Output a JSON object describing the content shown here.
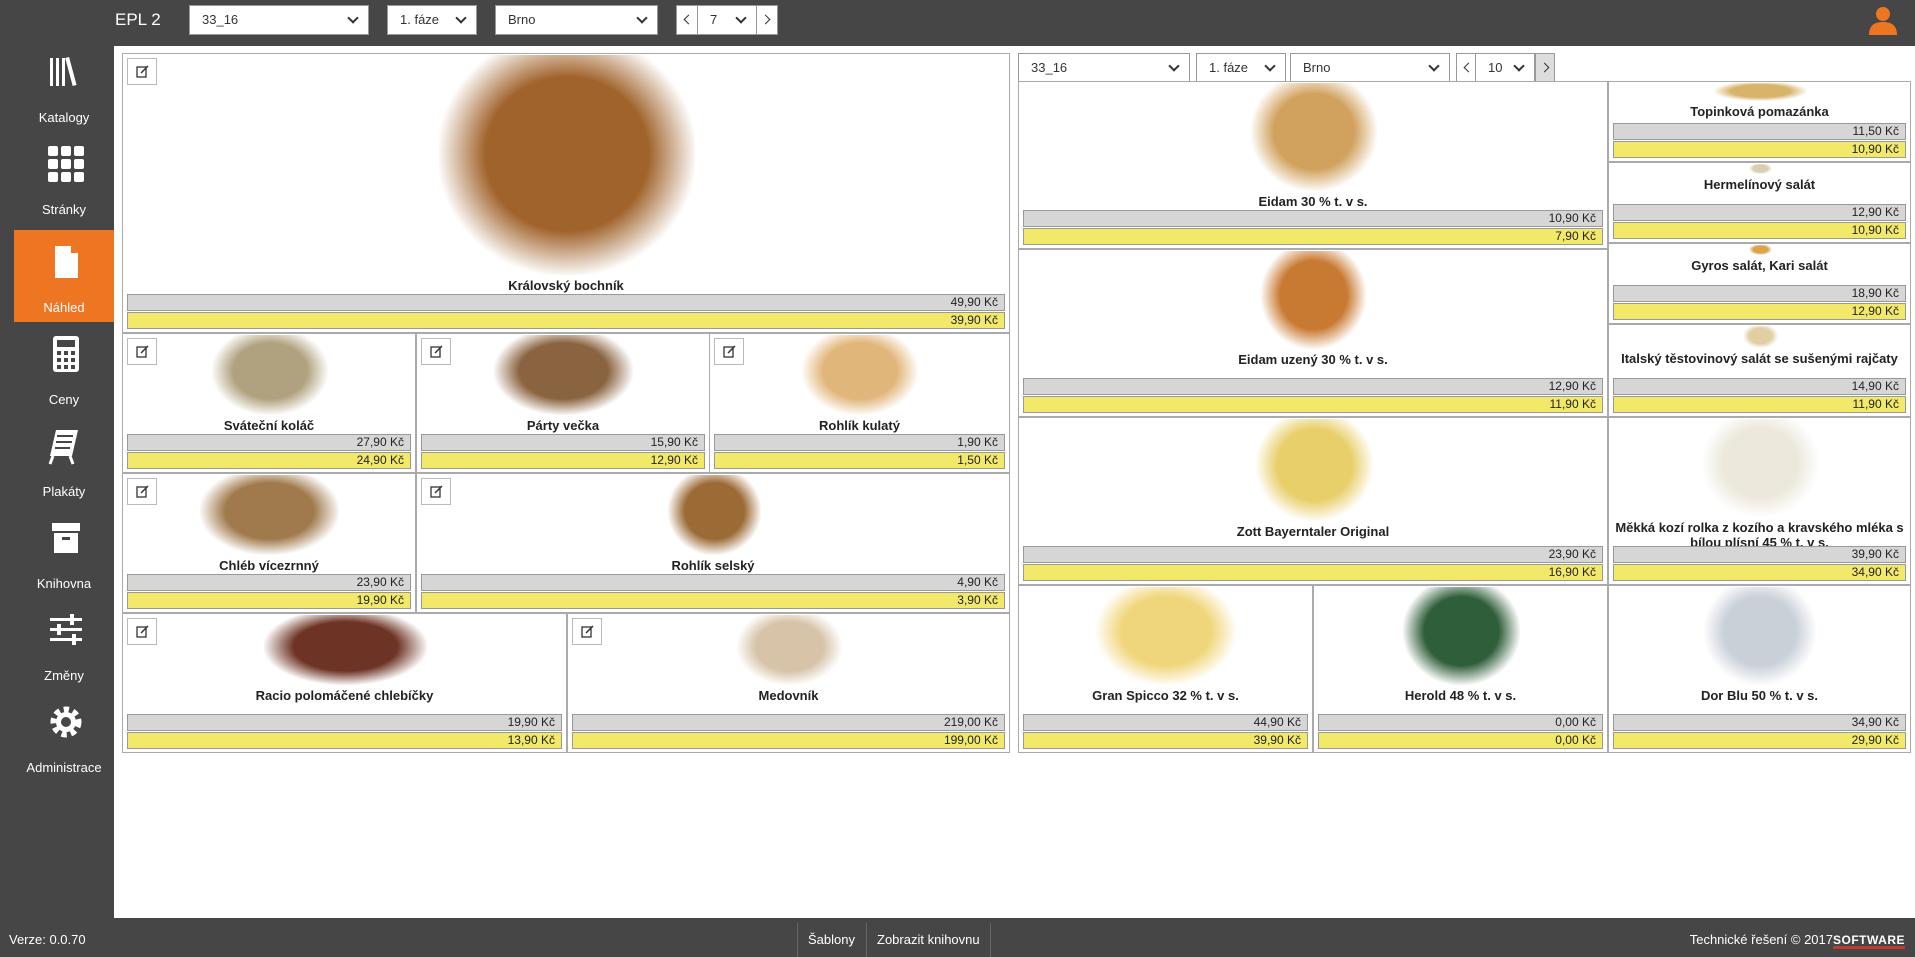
{
  "app": {
    "title": "EPL 2",
    "version": "Verze: 0.0.70"
  },
  "topbar": {
    "catalog": "33_16",
    "phase": "1. fáze",
    "city": "Brno",
    "page": "7"
  },
  "sidebar": {
    "items": [
      {
        "label": "Katalogy",
        "icon": "catalog-icon"
      },
      {
        "label": "Stránky",
        "icon": "grid-icon"
      },
      {
        "label": "Náhled",
        "icon": "document-icon",
        "active": true
      },
      {
        "label": "Ceny",
        "icon": "calculator-icon"
      },
      {
        "label": "Plakáty",
        "icon": "poster-icon"
      },
      {
        "label": "Knihovna",
        "icon": "archive-icon"
      },
      {
        "label": "Změny",
        "icon": "changes-icon"
      },
      {
        "label": "Administrace",
        "icon": "gear-icon"
      }
    ]
  },
  "footer": {
    "templates": "Šablony",
    "show_library": "Zobrazit knihovnu",
    "copyright": "Technické řešení © 2017",
    "logo": "SOFTWARE"
  },
  "left_products": [
    {
      "name": "Královský bochník",
      "price_old": "49,90 Kč",
      "price_new": "39,90 Kč",
      "color": "#a0632b"
    },
    {
      "name": "Sváteční koláč",
      "price_old": "27,90 Kč",
      "price_new": "24,90 Kč",
      "color": "#b0a27e"
    },
    {
      "name": "Párty večka",
      "price_old": "15,90 Kč",
      "price_new": "12,90 Kč",
      "color": "#8a6440"
    },
    {
      "name": "Rohlík kulatý",
      "price_old": "1,90 Kč",
      "price_new": "1,50 Kč",
      "color": "#e1b67a"
    },
    {
      "name": "Chléb vícezrnný",
      "price_old": "23,90 Kč",
      "price_new": "19,90 Kč",
      "color": "#a07a4c"
    },
    {
      "name": "Rohlík selský",
      "price_old": "4,90 Kč",
      "price_new": "3,90 Kč",
      "color": "#9b6a35"
    },
    {
      "name": "Racio polomáčené chlebíčky",
      "price_old": "19,90 Kč",
      "price_new": "13,90 Kč",
      "color": "#6d3324"
    },
    {
      "name": "Medovník",
      "price_old": "219,00 Kč",
      "price_new": "199,00 Kč",
      "color": "#d6c3a8"
    }
  ],
  "right_panel": {
    "catalog": "33_16",
    "phase": "1. fáze",
    "city": "Brno",
    "page": "10"
  },
  "right_products": [
    {
      "name": "Eidam 30 % t. v s.",
      "price_old": "10,90 Kč",
      "price_new": "7,90 Kč",
      "color": "#d1a25e"
    },
    {
      "name": "Topinková pomazánka",
      "price_old": "11,50 Kč",
      "price_new": "10,90 Kč",
      "color": "#d7b46a"
    },
    {
      "name": "Hermelínový salát",
      "price_old": "12,90 Kč",
      "price_new": "10,90 Kč",
      "color": "#d8ceb0"
    },
    {
      "name": "Eidam uzený 30 % t. v s.",
      "price_old": "12,90 Kč",
      "price_new": "11,90 Kč",
      "color": "#c97a32"
    },
    {
      "name": "Gyros salát, Kari salát",
      "price_old": "18,90 Kč",
      "price_new": "12,90 Kč",
      "color": "#d9a44c"
    },
    {
      "name": "Italský těstovinový salát se sušenými rajčaty",
      "price_old": "14,90 Kč",
      "price_new": "11,90 Kč",
      "color": "#e0cfa2"
    },
    {
      "name": "Zott Bayerntaler Original",
      "price_old": "23,90 Kč",
      "price_new": "16,90 Kč",
      "color": "#e8cf6a"
    },
    {
      "name": "Měkká kozí rolka z kozího a kravského mléka s bílou plísní 45 % t. v s.",
      "price_old": "39,90 Kč",
      "price_new": "34,90 Kč",
      "color": "#ece8dc"
    },
    {
      "name": "Gran Spicco 32 % t. v s.",
      "price_old": "44,90 Kč",
      "price_new": "39,90 Kč",
      "color": "#f0d67a"
    },
    {
      "name": "Herold 48 % t. v s.",
      "price_old": "0,00 Kč",
      "price_new": "0,00 Kč",
      "color": "#2f5e3a"
    },
    {
      "name": "Dor Blu 50 % t. v s.",
      "price_old": "34,90 Kč",
      "price_new": "29,90 Kč",
      "color": "#c9d0d8"
    }
  ]
}
